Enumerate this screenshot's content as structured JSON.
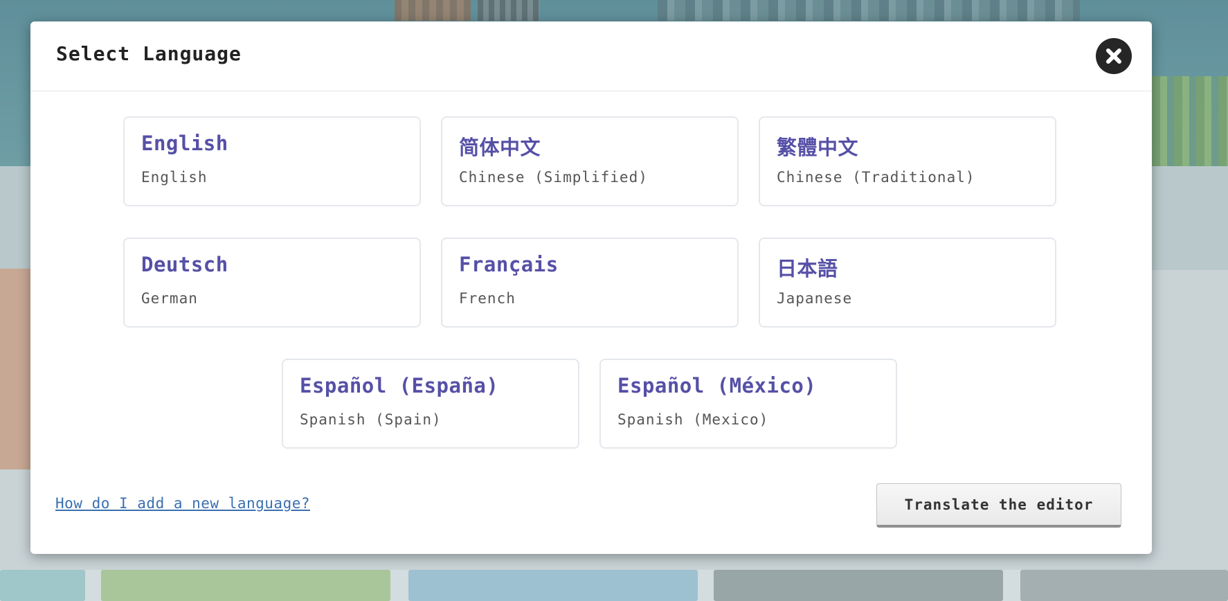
{
  "modal": {
    "title": "Select Language",
    "close_icon": "close-icon"
  },
  "languages": [
    {
      "native": "English",
      "english": "English"
    },
    {
      "native": "简体中文",
      "english": "Chinese (Simplified)"
    },
    {
      "native": "繁體中文",
      "english": "Chinese (Traditional)"
    },
    {
      "native": "Deutsch",
      "english": "German"
    },
    {
      "native": "Français",
      "english": "French"
    },
    {
      "native": "日本語",
      "english": "Japanese"
    },
    {
      "native": "Español (España)",
      "english": "Spanish (Spain)"
    },
    {
      "native": "Español (México)",
      "english": "Spanish (Mexico)"
    }
  ],
  "footer": {
    "help_link": "How do I add a new language?",
    "translate_button": "Translate the editor"
  },
  "colors": {
    "accent": "#5650a6",
    "link": "#3a6fb0",
    "close_bg": "#262626"
  }
}
